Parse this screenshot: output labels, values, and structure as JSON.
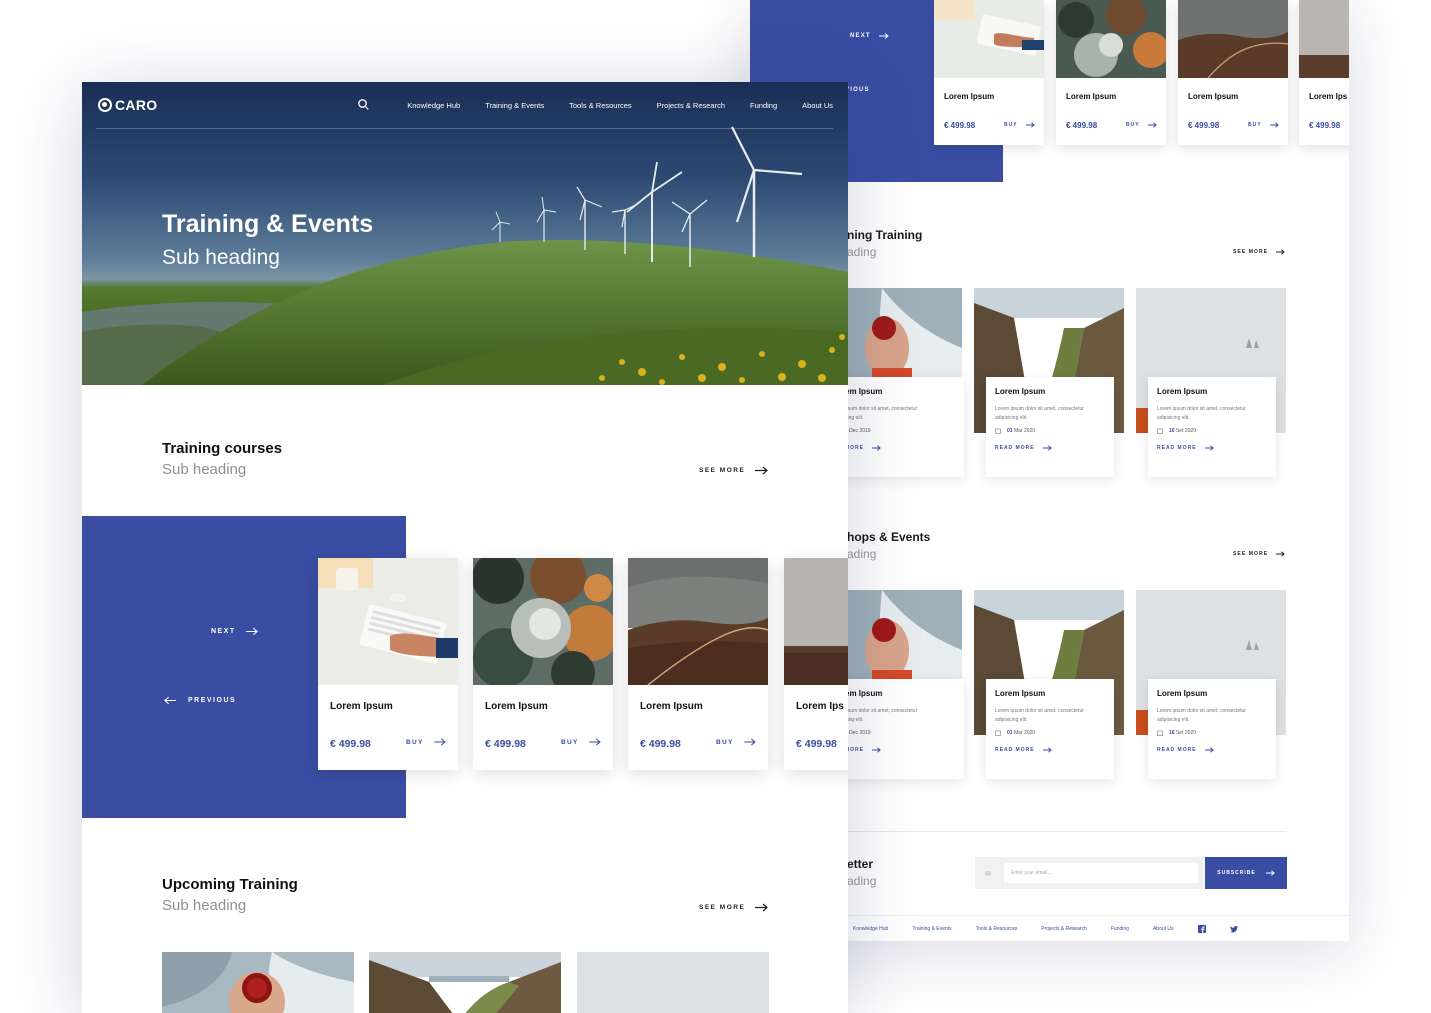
{
  "brand": {
    "name": "CARO",
    "accent": "#3a4da3"
  },
  "nav": {
    "items": [
      "Knowledge Hub",
      "Training & Events",
      "Tools & Resources",
      "Projects & Research",
      "Funding",
      "About Us"
    ]
  },
  "hero": {
    "title": "Training & Events",
    "subtitle": "Sub heading"
  },
  "training_courses": {
    "title": "Training courses",
    "subtitle": "Sub heading",
    "see_more": "SEE MORE",
    "next": "NEXT",
    "previous": "PREVIOUS",
    "buy_label": "BUY",
    "cards": [
      {
        "title": "Lorem Ipsum",
        "price": "€ 499.98",
        "image": "desk-keyboard"
      },
      {
        "title": "Lorem Ipsum",
        "price": "€ 499.98",
        "image": "forest-aerial"
      },
      {
        "title": "Lorem Ipsum",
        "price": "€ 499.98",
        "image": "valley-road"
      },
      {
        "title": "Lorem Ips",
        "price": "€ 499.98",
        "image": "misty-field"
      }
    ]
  },
  "upcoming_training": {
    "title": "Upcoming Training",
    "subtitle": "Sub heading",
    "see_more": "SEE MORE"
  },
  "back_page": {
    "next": "NEXT",
    "previous": "VIOUS",
    "cards": [
      {
        "title": "Lorem Ipsum",
        "price": "€ 499.98",
        "buy": "BUY"
      },
      {
        "title": "Lorem Ipsum",
        "price": "€ 499.98",
        "buy": "BUY"
      },
      {
        "title": "Lorem Ipsum",
        "price": "€ 499.98",
        "buy": "BUY"
      },
      {
        "title": "Lorem Ips",
        "price": "€ 499.98",
        "buy": ""
      }
    ],
    "upcoming": {
      "title": "ning Training",
      "subtitle": "ading",
      "see_more": "SEE MORE",
      "items": [
        {
          "title": "em Ipsum",
          "desc1": "psum dolor sit amet, consectetur",
          "desc2": "cing elit.",
          "date_bold": "",
          "date": "9 Dec 2019",
          "read_more": "MORE"
        },
        {
          "title": "Lorem Ipsum",
          "desc1": "Lorem ipsum dolor sit amet, consectetur",
          "desc2": "adipisicing elit.",
          "date_bold": "01",
          "date": "Mar 2020",
          "read_more": "READ MORE"
        },
        {
          "title": "Lorem Ipsum",
          "desc1": "Lorem ipsum dolor sit amet, consectetur",
          "desc2": "adipisicing elit.",
          "date_bold": "16",
          "date": "Set 2020",
          "read_more": "READ MORE"
        }
      ]
    },
    "workshops": {
      "title": "hops & Events",
      "subtitle": "ading",
      "see_more": "SEE MORE",
      "items": [
        {
          "title": "em Ipsum",
          "desc1": "psum dolor sit amet, consectetur",
          "desc2": "cing elit.",
          "date_bold": "",
          "date": "9 Dec 2019",
          "read_more": "MORE"
        },
        {
          "title": "Lorem Ipsum",
          "desc1": "Lorem ipsum dolor sit amet, consectetur",
          "desc2": "adipisicing elit.",
          "date_bold": "01",
          "date": "Mar 2020",
          "read_more": "READ MORE"
        },
        {
          "title": "Lorem Ipsum",
          "desc1": "Lorem ipsum dolor sit amet, consectetur",
          "desc2": "adipisicing elit.",
          "date_bold": "16",
          "date": "Set 2020",
          "read_more": "READ MORE"
        }
      ]
    },
    "newsletter": {
      "title": "etter",
      "subtitle": "ading",
      "placeholder": "Enter your email...",
      "subscribe": "SUBSCRIBE"
    },
    "footer_links": [
      "Knowledge Hub",
      "Training & Events",
      "Tools & Resources",
      "Projects & Research",
      "Funding",
      "About Us"
    ]
  }
}
